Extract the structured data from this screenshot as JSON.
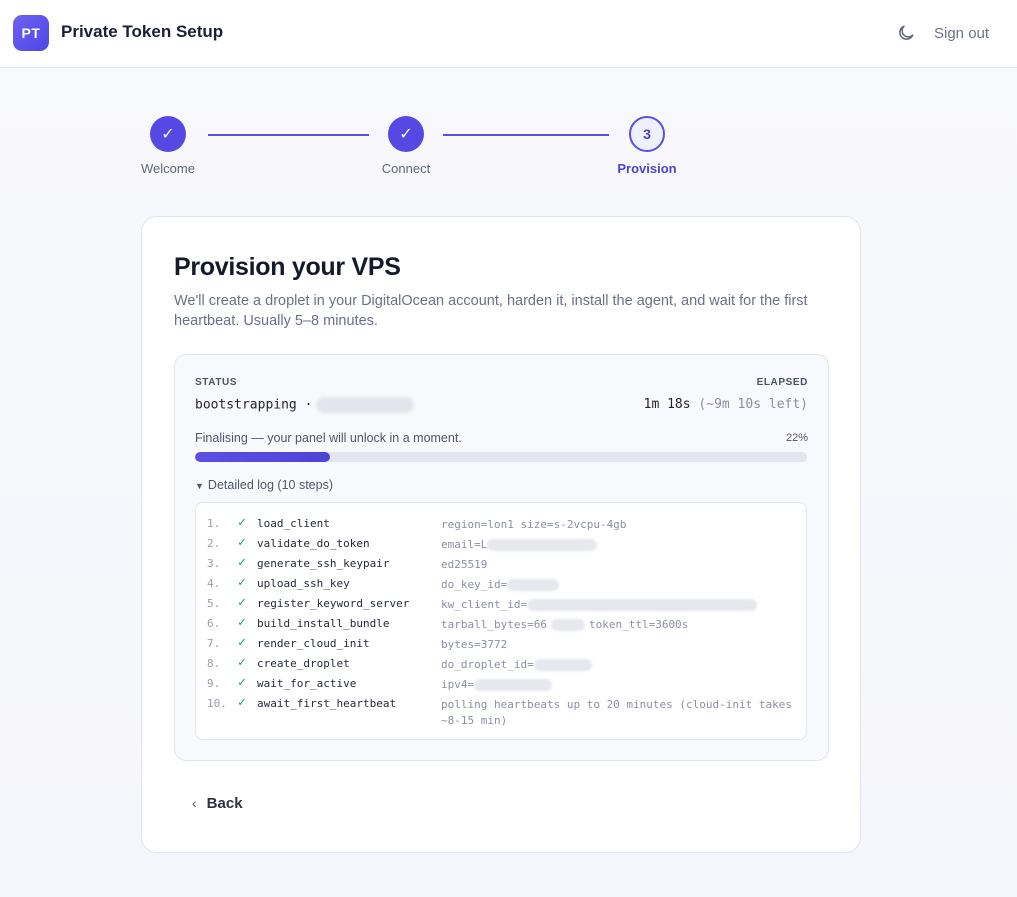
{
  "header": {
    "logo_text": "PT",
    "title": "Private Token Setup",
    "theme_icon": "moon-icon",
    "signout_label": "Sign out"
  },
  "stepper": {
    "steps": [
      {
        "label": "Welcome",
        "state": "done",
        "marker": "✓"
      },
      {
        "label": "Connect",
        "state": "done",
        "marker": "✓"
      },
      {
        "label": "Provision",
        "state": "current",
        "marker": "3"
      }
    ]
  },
  "card": {
    "title": "Provision your VPS",
    "description": "We'll create a droplet in your DigitalOcean account, harden it, install the agent, and wait for the first heartbeat. Usually 5–8 minutes."
  },
  "status": {
    "status_label": "STATUS",
    "status_value": "bootstrapping ·",
    "elapsed_label": "ELAPSED",
    "elapsed_value": "1m 18s",
    "elapsed_remaining": "(~9m 10s left)",
    "progress_message": "Finalising — your panel will unlock in a moment.",
    "progress_text": "22%",
    "progress_fraction": 0.22
  },
  "log": {
    "toggle_label": "Detailed log (10 steps)",
    "rows": [
      {
        "num": "1.",
        "check": "✓",
        "step": "load_client",
        "detail": "region=lon1 size=s-2vcpu-4gb"
      },
      {
        "num": "2.",
        "check": "✓",
        "step": "validate_do_token",
        "detail": "email=L"
      },
      {
        "num": "3.",
        "check": "✓",
        "step": "generate_ssh_keypair",
        "detail": "ed25519"
      },
      {
        "num": "4.",
        "check": "✓",
        "step": "upload_ssh_key",
        "detail": "do_key_id="
      },
      {
        "num": "5.",
        "check": "✓",
        "step": "register_keyword_server",
        "detail": "kw_client_id="
      },
      {
        "num": "6.",
        "check": "✓",
        "step": "build_install_bundle",
        "detail": "tarball_bytes=66"
      },
      {
        "num": "7.",
        "check": "✓",
        "step": "render_cloud_init",
        "detail": "bytes=3772"
      },
      {
        "num": "8.",
        "check": "✓",
        "step": "create_droplet",
        "detail": "do_droplet_id="
      },
      {
        "num": "9.",
        "check": "✓",
        "step": "wait_for_active",
        "detail": "ipv4="
      },
      {
        "num": "10.",
        "check": "✓",
        "step": "await_first_heartbeat",
        "detail": "polling heartbeats up to 20 minutes (cloud-init takes ~8-15 min)"
      }
    ],
    "row6_tail": "token_ttl=3600s"
  },
  "actions": {
    "back_label": "Back"
  }
}
